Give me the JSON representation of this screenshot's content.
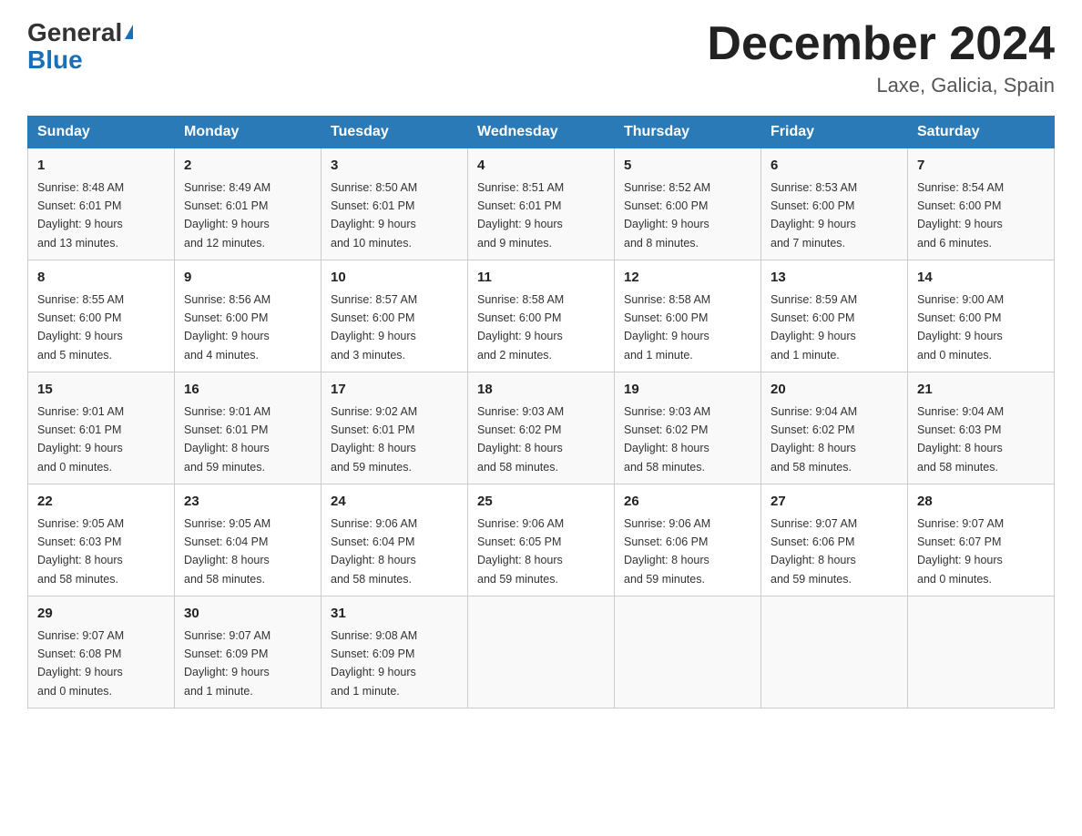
{
  "header": {
    "logo_general": "General",
    "logo_blue": "Blue",
    "month_title": "December 2024",
    "location": "Laxe, Galicia, Spain"
  },
  "days_of_week": [
    "Sunday",
    "Monday",
    "Tuesday",
    "Wednesday",
    "Thursday",
    "Friday",
    "Saturday"
  ],
  "weeks": [
    [
      {
        "date": "1",
        "sunrise": "Sunrise: 8:48 AM",
        "sunset": "Sunset: 6:01 PM",
        "daylight": "Daylight: 9 hours",
        "minutes": "and 13 minutes."
      },
      {
        "date": "2",
        "sunrise": "Sunrise: 8:49 AM",
        "sunset": "Sunset: 6:01 PM",
        "daylight": "Daylight: 9 hours",
        "minutes": "and 12 minutes."
      },
      {
        "date": "3",
        "sunrise": "Sunrise: 8:50 AM",
        "sunset": "Sunset: 6:01 PM",
        "daylight": "Daylight: 9 hours",
        "minutes": "and 10 minutes."
      },
      {
        "date": "4",
        "sunrise": "Sunrise: 8:51 AM",
        "sunset": "Sunset: 6:01 PM",
        "daylight": "Daylight: 9 hours",
        "minutes": "and 9 minutes."
      },
      {
        "date": "5",
        "sunrise": "Sunrise: 8:52 AM",
        "sunset": "Sunset: 6:00 PM",
        "daylight": "Daylight: 9 hours",
        "minutes": "and 8 minutes."
      },
      {
        "date": "6",
        "sunrise": "Sunrise: 8:53 AM",
        "sunset": "Sunset: 6:00 PM",
        "daylight": "Daylight: 9 hours",
        "minutes": "and 7 minutes."
      },
      {
        "date": "7",
        "sunrise": "Sunrise: 8:54 AM",
        "sunset": "Sunset: 6:00 PM",
        "daylight": "Daylight: 9 hours",
        "minutes": "and 6 minutes."
      }
    ],
    [
      {
        "date": "8",
        "sunrise": "Sunrise: 8:55 AM",
        "sunset": "Sunset: 6:00 PM",
        "daylight": "Daylight: 9 hours",
        "minutes": "and 5 minutes."
      },
      {
        "date": "9",
        "sunrise": "Sunrise: 8:56 AM",
        "sunset": "Sunset: 6:00 PM",
        "daylight": "Daylight: 9 hours",
        "minutes": "and 4 minutes."
      },
      {
        "date": "10",
        "sunrise": "Sunrise: 8:57 AM",
        "sunset": "Sunset: 6:00 PM",
        "daylight": "Daylight: 9 hours",
        "minutes": "and 3 minutes."
      },
      {
        "date": "11",
        "sunrise": "Sunrise: 8:58 AM",
        "sunset": "Sunset: 6:00 PM",
        "daylight": "Daylight: 9 hours",
        "minutes": "and 2 minutes."
      },
      {
        "date": "12",
        "sunrise": "Sunrise: 8:58 AM",
        "sunset": "Sunset: 6:00 PM",
        "daylight": "Daylight: 9 hours",
        "minutes": "and 1 minute."
      },
      {
        "date": "13",
        "sunrise": "Sunrise: 8:59 AM",
        "sunset": "Sunset: 6:00 PM",
        "daylight": "Daylight: 9 hours",
        "minutes": "and 1 minute."
      },
      {
        "date": "14",
        "sunrise": "Sunrise: 9:00 AM",
        "sunset": "Sunset: 6:00 PM",
        "daylight": "Daylight: 9 hours",
        "minutes": "and 0 minutes."
      }
    ],
    [
      {
        "date": "15",
        "sunrise": "Sunrise: 9:01 AM",
        "sunset": "Sunset: 6:01 PM",
        "daylight": "Daylight: 9 hours",
        "minutes": "and 0 minutes."
      },
      {
        "date": "16",
        "sunrise": "Sunrise: 9:01 AM",
        "sunset": "Sunset: 6:01 PM",
        "daylight": "Daylight: 8 hours",
        "minutes": "and 59 minutes."
      },
      {
        "date": "17",
        "sunrise": "Sunrise: 9:02 AM",
        "sunset": "Sunset: 6:01 PM",
        "daylight": "Daylight: 8 hours",
        "minutes": "and 59 minutes."
      },
      {
        "date": "18",
        "sunrise": "Sunrise: 9:03 AM",
        "sunset": "Sunset: 6:02 PM",
        "daylight": "Daylight: 8 hours",
        "minutes": "and 58 minutes."
      },
      {
        "date": "19",
        "sunrise": "Sunrise: 9:03 AM",
        "sunset": "Sunset: 6:02 PM",
        "daylight": "Daylight: 8 hours",
        "minutes": "and 58 minutes."
      },
      {
        "date": "20",
        "sunrise": "Sunrise: 9:04 AM",
        "sunset": "Sunset: 6:02 PM",
        "daylight": "Daylight: 8 hours",
        "minutes": "and 58 minutes."
      },
      {
        "date": "21",
        "sunrise": "Sunrise: 9:04 AM",
        "sunset": "Sunset: 6:03 PM",
        "daylight": "Daylight: 8 hours",
        "minutes": "and 58 minutes."
      }
    ],
    [
      {
        "date": "22",
        "sunrise": "Sunrise: 9:05 AM",
        "sunset": "Sunset: 6:03 PM",
        "daylight": "Daylight: 8 hours",
        "minutes": "and 58 minutes."
      },
      {
        "date": "23",
        "sunrise": "Sunrise: 9:05 AM",
        "sunset": "Sunset: 6:04 PM",
        "daylight": "Daylight: 8 hours",
        "minutes": "and 58 minutes."
      },
      {
        "date": "24",
        "sunrise": "Sunrise: 9:06 AM",
        "sunset": "Sunset: 6:04 PM",
        "daylight": "Daylight: 8 hours",
        "minutes": "and 58 minutes."
      },
      {
        "date": "25",
        "sunrise": "Sunrise: 9:06 AM",
        "sunset": "Sunset: 6:05 PM",
        "daylight": "Daylight: 8 hours",
        "minutes": "and 59 minutes."
      },
      {
        "date": "26",
        "sunrise": "Sunrise: 9:06 AM",
        "sunset": "Sunset: 6:06 PM",
        "daylight": "Daylight: 8 hours",
        "minutes": "and 59 minutes."
      },
      {
        "date": "27",
        "sunrise": "Sunrise: 9:07 AM",
        "sunset": "Sunset: 6:06 PM",
        "daylight": "Daylight: 8 hours",
        "minutes": "and 59 minutes."
      },
      {
        "date": "28",
        "sunrise": "Sunrise: 9:07 AM",
        "sunset": "Sunset: 6:07 PM",
        "daylight": "Daylight: 9 hours",
        "minutes": "and 0 minutes."
      }
    ],
    [
      {
        "date": "29",
        "sunrise": "Sunrise: 9:07 AM",
        "sunset": "Sunset: 6:08 PM",
        "daylight": "Daylight: 9 hours",
        "minutes": "and 0 minutes."
      },
      {
        "date": "30",
        "sunrise": "Sunrise: 9:07 AM",
        "sunset": "Sunset: 6:09 PM",
        "daylight": "Daylight: 9 hours",
        "minutes": "and 1 minute."
      },
      {
        "date": "31",
        "sunrise": "Sunrise: 9:08 AM",
        "sunset": "Sunset: 6:09 PM",
        "daylight": "Daylight: 9 hours",
        "minutes": "and 1 minute."
      },
      {
        "date": "",
        "sunrise": "",
        "sunset": "",
        "daylight": "",
        "minutes": ""
      },
      {
        "date": "",
        "sunrise": "",
        "sunset": "",
        "daylight": "",
        "minutes": ""
      },
      {
        "date": "",
        "sunrise": "",
        "sunset": "",
        "daylight": "",
        "minutes": ""
      },
      {
        "date": "",
        "sunrise": "",
        "sunset": "",
        "daylight": "",
        "minutes": ""
      }
    ]
  ]
}
